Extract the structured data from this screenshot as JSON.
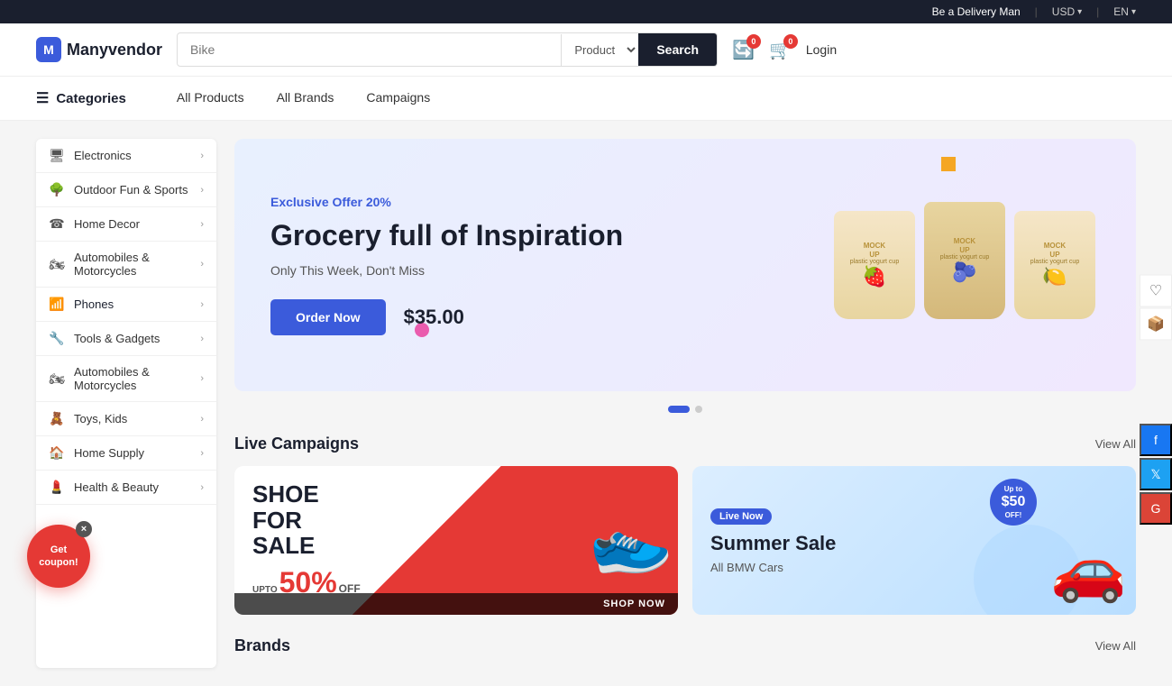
{
  "topBar": {
    "delivery": "Be a Delivery Man",
    "separator": "|",
    "currency": "USD",
    "lang": "EN"
  },
  "header": {
    "logoText": "Manyvendor",
    "searchPlaceholder": "Bike",
    "searchCategory": "Product",
    "searchBtn": "Search",
    "wishlistBadge": "0",
    "cartBadge": "0",
    "login": "Login"
  },
  "nav": {
    "categories": "Categories",
    "links": [
      "All Products",
      "All Brands",
      "Campaigns"
    ]
  },
  "sidebar": {
    "categories": [
      {
        "icon": "🖥",
        "label": "Electronics"
      },
      {
        "icon": "🌳",
        "label": "Outdoor Fun & Sports"
      },
      {
        "icon": "☎",
        "label": "Home Decor"
      },
      {
        "icon": "🏍",
        "label": "Automobiles & Motorcycles"
      },
      {
        "icon": "📶",
        "label": "Phones"
      },
      {
        "icon": "🔧",
        "label": "Tools & Gadgets"
      },
      {
        "icon": "🏍",
        "label": "Automobiles & Motorcycles"
      },
      {
        "icon": "🧸",
        "label": "Toys, Kids"
      },
      {
        "icon": "🏠",
        "label": "Home Supply"
      },
      {
        "icon": "💄",
        "label": "Health & Beauty"
      }
    ]
  },
  "hero": {
    "offer": "Exclusive Offer 20%",
    "title": "Grocery full of Inspiration",
    "subtitle": "Only This Week, Don't Miss",
    "orderBtn": "Order Now",
    "price": "$35.00",
    "cups": [
      {
        "fruit": "🍓"
      },
      {
        "fruit": "🫐"
      },
      {
        "fruit": "🍋"
      }
    ]
  },
  "liveCampaigns": {
    "title": "Live Campaigns",
    "viewAll": "View All",
    "campaigns": [
      {
        "type": "shoe",
        "title": "SHOE FOR SALE",
        "upTo": "UPTO",
        "percent": "50%",
        "off": "OFF",
        "shopNow": "SHOP NOW"
      },
      {
        "type": "car",
        "liveBadge": "Live Now",
        "title": "Summer Sale",
        "subtitle": "All BMW Cars",
        "badgeTop": "Up to",
        "badgeAmount": "$50",
        "badgeOff": "OFF!"
      }
    ]
  },
  "brands": {
    "title": "Brands",
    "viewAll": "View All"
  },
  "coupon": {
    "label": "Get\ncoupon!",
    "closeIcon": "×"
  },
  "social": {
    "facebook": "f",
    "twitter": "𝕏",
    "google": "G"
  },
  "rightPanel": {
    "wishlistIcon": "♡",
    "trackIcon": "📦"
  }
}
